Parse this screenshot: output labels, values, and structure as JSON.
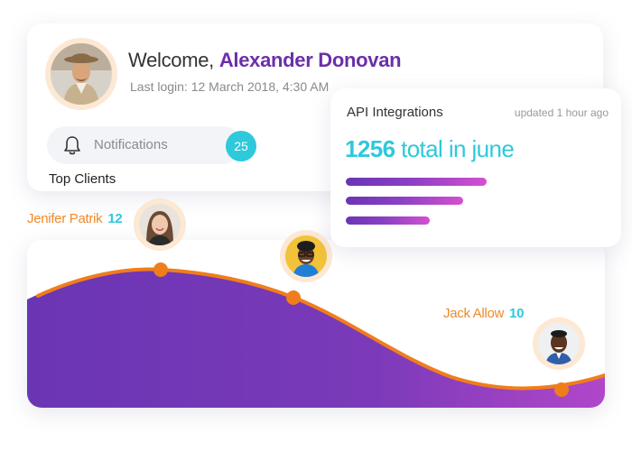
{
  "profile": {
    "welcome_prefix": "Welcome,",
    "name": "Alexander Donovan",
    "last_login": "Last login: 12 March 2018, 4:30 AM",
    "avatar_icon": "user-avatar-icon"
  },
  "notifications": {
    "label": "Notifications",
    "count": "25",
    "icon": "bell-icon"
  },
  "top_clients": {
    "title": "Top Clients",
    "clients": [
      {
        "name": "Jenifer Patrik",
        "count": "12"
      },
      {
        "name": "",
        "count": ""
      },
      {
        "name": "Jack Allow",
        "count": "10"
      }
    ]
  },
  "api": {
    "title": "API Integrations",
    "updated": "updated 1 hour ago",
    "total_number": "1256",
    "total_suffix": "total in june",
    "bars": [
      0.84,
      0.7,
      0.5
    ]
  },
  "colors": {
    "accent_purple": "#6b2fa8",
    "accent_cyan": "#2ec9db",
    "accent_orange": "#ef8a2a",
    "avatar_ring": "#fde8d4"
  }
}
